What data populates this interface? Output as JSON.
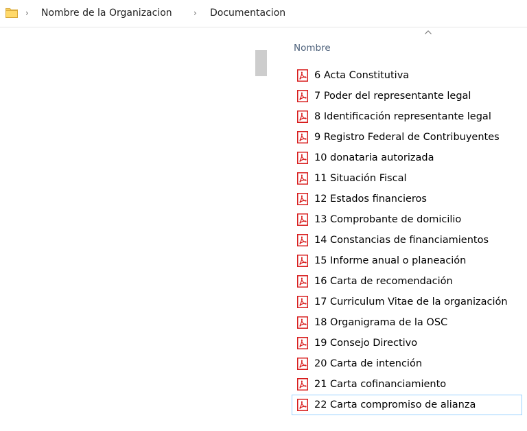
{
  "breadcrumb": {
    "items": [
      {
        "label": "Nombre de la Organizacion"
      },
      {
        "label": "Documentacion"
      }
    ]
  },
  "file_list": {
    "column_header": "Nombre",
    "files": [
      {
        "name": "6  Acta Constitutiva",
        "icon": "pdf-icon"
      },
      {
        "name": "7 Poder del representante legal",
        "icon": "pdf-icon"
      },
      {
        "name": "8 Identificación representante legal",
        "icon": "pdf-icon"
      },
      {
        "name": "9 Registro Federal de Contribuyentes",
        "icon": "pdf-icon"
      },
      {
        "name": "10 donataria autorizada",
        "icon": "pdf-icon"
      },
      {
        "name": "11 Situación Fiscal",
        "icon": "pdf-icon"
      },
      {
        "name": "12 Estados financieros",
        "icon": "pdf-icon"
      },
      {
        "name": "13 Comprobante de domicilio",
        "icon": "pdf-icon"
      },
      {
        "name": "14 Constancias de financiamientos",
        "icon": "pdf-icon"
      },
      {
        "name": "15 Informe anual o planeación",
        "icon": "pdf-icon"
      },
      {
        "name": "16 Carta de recomendación",
        "icon": "pdf-icon"
      },
      {
        "name": "17 Curriculum Vitae de la organización",
        "icon": "pdf-icon"
      },
      {
        "name": "18 Organigrama de la OSC",
        "icon": "pdf-icon"
      },
      {
        "name": "19 Consejo Directivo",
        "icon": "pdf-icon"
      },
      {
        "name": "20 Carta de intención",
        "icon": "pdf-icon"
      },
      {
        "name": "21 Carta cofinanciamiento",
        "icon": "pdf-icon"
      },
      {
        "name": "22 Carta compromiso de alianza",
        "icon": "pdf-icon",
        "focused": true
      }
    ]
  },
  "colors": {
    "pdf_red": "#d81e1e",
    "folder_yellow": "#f7cd5c",
    "focus_border": "#99d1ff",
    "header_text": "#4c607a",
    "scroll_thumb": "#cdcdcd"
  }
}
